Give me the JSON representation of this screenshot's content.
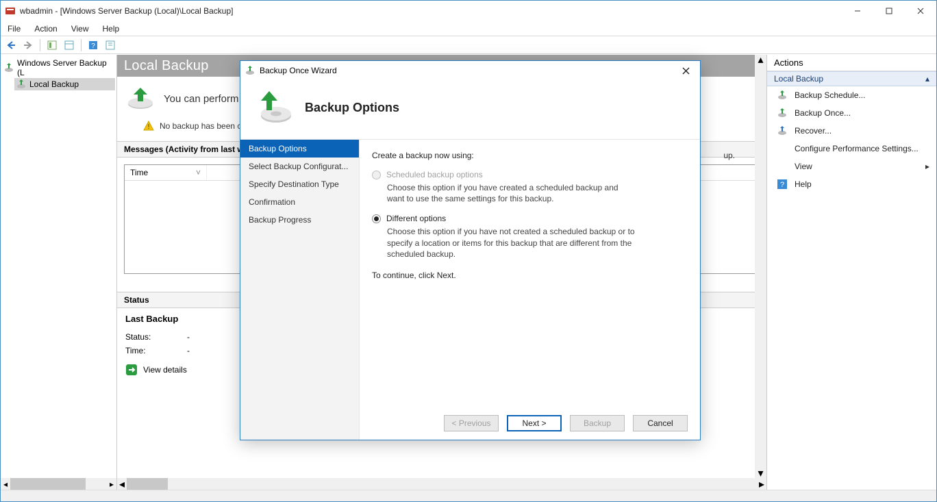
{
  "window": {
    "title": "wbadmin - [Windows Server Backup (Local)\\Local Backup]"
  },
  "menubar": [
    "File",
    "Action",
    "View",
    "Help"
  ],
  "tree": {
    "root": "Windows Server Backup (L",
    "child": "Local Backup"
  },
  "local_backup": {
    "header": "Local Backup",
    "perform": "You can perform",
    "alert_text": "No backup has been co",
    "messages_header": "Messages (Activity from last w",
    "col_time": "Time",
    "status_header": "Status",
    "last_backup": "Last Backup",
    "status_k": "Status:",
    "status_v": "-",
    "time_k": "Time:",
    "time_v": "-",
    "view_details": "View details",
    "overflow_text": "up."
  },
  "actions": {
    "title": "Actions",
    "section": "Local Backup",
    "items": [
      "Backup Schedule...",
      "Backup Once...",
      "Recover...",
      "Configure Performance Settings...",
      "View",
      "Help"
    ]
  },
  "wizard": {
    "title": "Backup Once Wizard",
    "heading": "Backup Options",
    "steps": [
      "Backup Options",
      "Select Backup Configurat...",
      "Specify Destination Type",
      "Confirmation",
      "Backup Progress"
    ],
    "intro": "Create a backup now using:",
    "option1_label": "Scheduled backup options",
    "option1_desc": "Choose this option if you have created a scheduled backup and want to use the same settings for this backup.",
    "option2_label": "Different options",
    "option2_desc": "Choose this option if you have not created a scheduled backup or to specify a location or items for this backup that are different from the scheduled backup.",
    "continue_text": "To continue, click Next.",
    "buttons": {
      "previous": "< Previous",
      "next": "Next >",
      "backup": "Backup",
      "cancel": "Cancel"
    }
  }
}
